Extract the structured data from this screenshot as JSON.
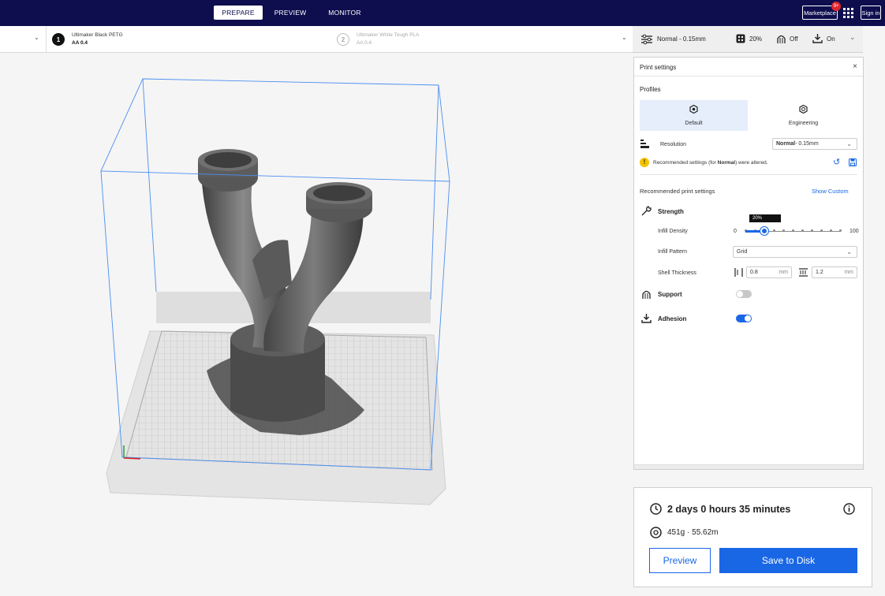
{
  "topbar": {
    "tabs": [
      {
        "label": "PREPARE",
        "active": true
      },
      {
        "label": "PREVIEW",
        "active": false
      },
      {
        "label": "MONITOR",
        "active": false
      }
    ],
    "marketplace_label": "Marketplace",
    "marketplace_badge": "9+",
    "signin_label": "Sign in",
    "apps_icon": "grid-apps-icon"
  },
  "extruders": [
    {
      "index": "1",
      "material": "Ultimaker Black PETG",
      "core": "AA 0.4",
      "enabled": true
    },
    {
      "index": "2",
      "material": "Ultimaker White Tough PLA",
      "core": "AA 0.4",
      "enabled": false
    }
  ],
  "settings_summary": {
    "profile": "Normal - 0.15mm",
    "infill": "20%",
    "support": "Off",
    "adhesion": "On"
  },
  "print_settings": {
    "title": "Print settings",
    "profiles_label": "Profiles",
    "profiles": [
      {
        "label": "Default",
        "selected": true
      },
      {
        "label": "Engineering",
        "selected": false
      }
    ],
    "resolution_label": "Resolution",
    "resolution_bold": "Normal",
    "resolution_rest": " - 0.15mm",
    "warning_prefix": "Recommended settings (for ",
    "warning_bold": "Normal",
    "warning_suffix": ") were altered.",
    "recommended_label": "Recommended print settings",
    "show_custom": "Show Custom",
    "strength_label": "Strength",
    "infill_density_label": "Infill Density",
    "infill_tooltip": "20%",
    "infill_min": "0",
    "infill_max": "100",
    "infill_value": 20,
    "infill_pattern_label": "Infill Pattern",
    "infill_pattern": "Grid",
    "shell_label": "Shell Thickness",
    "wall_thickness": "0.8",
    "top_bottom_thickness": "1.2",
    "unit": "mm",
    "support_label": "Support",
    "support_enabled": false,
    "adhesion_label": "Adhesion",
    "adhesion_enabled": true
  },
  "job": {
    "print_time": "2 days 0 hours 35 minutes",
    "material_usage": "451g · 55.62m",
    "preview_label": "Preview",
    "save_label": "Save to Disk"
  },
  "colors": {
    "header_bg": "#0e0e4f",
    "accent": "#1a67e6",
    "model": "#5a5a5a",
    "build_volume": "#4a8ef2",
    "warning": "#f5c400"
  }
}
